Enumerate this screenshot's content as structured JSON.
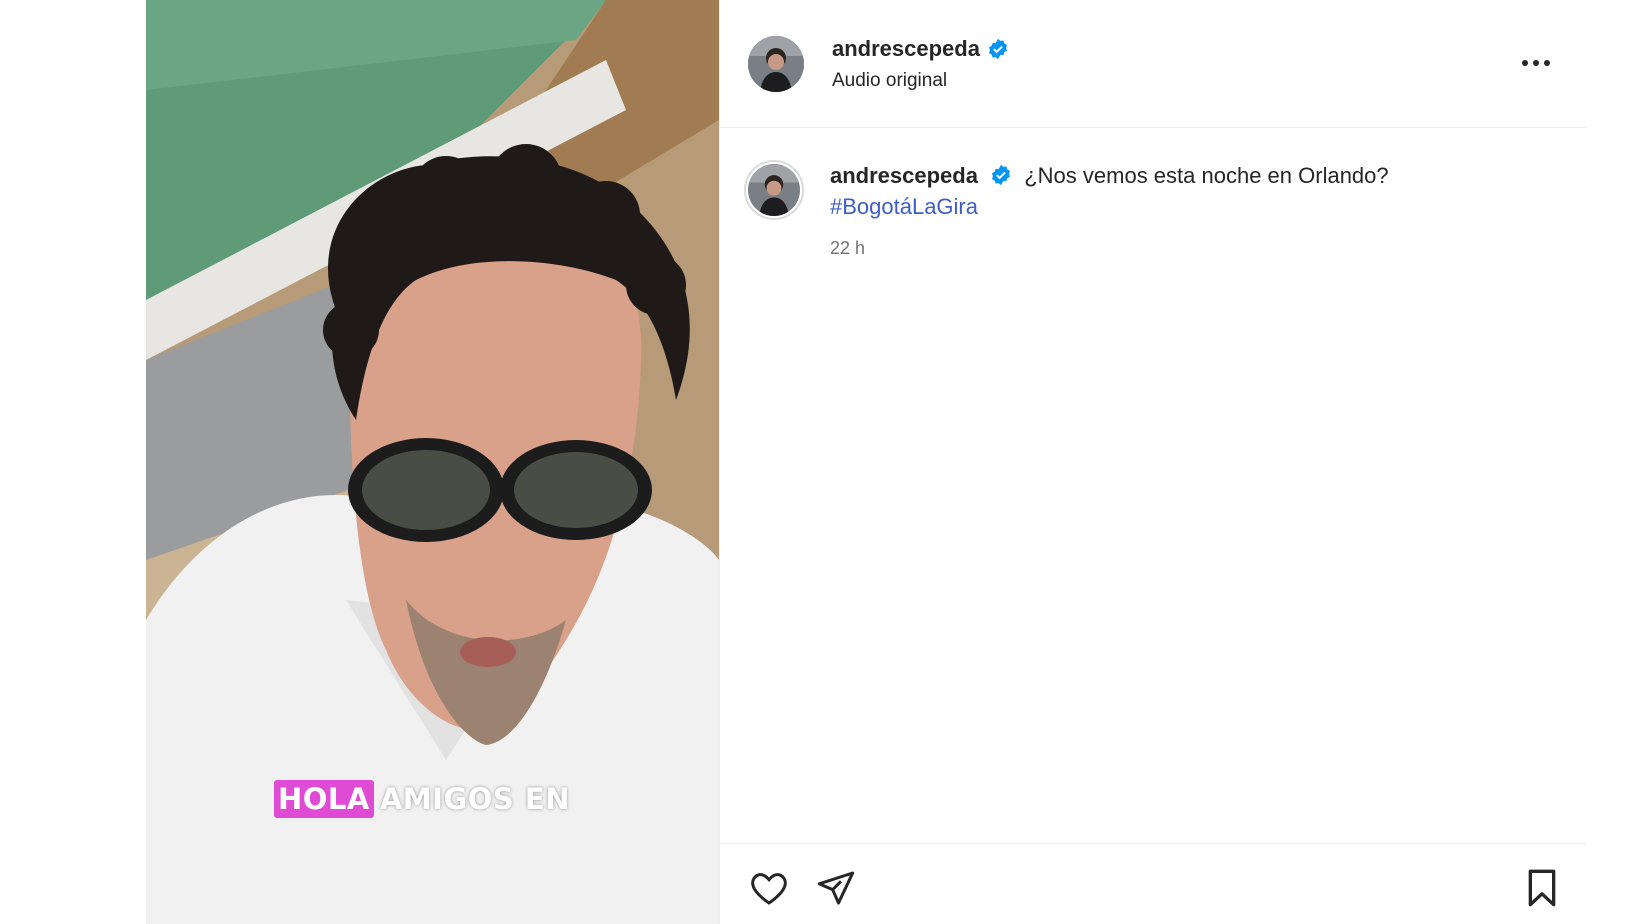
{
  "post": {
    "media": {
      "overlay_highlight": "HOLA",
      "overlay_text": "AMIGOS EN"
    },
    "header": {
      "username": "andrescepeda",
      "verified": true,
      "audio": "Audio original",
      "more_icon": "more-horizontal-icon"
    },
    "caption": {
      "username": "andrescepeda",
      "text": "¿Nos vemos esta noche en Orlando?",
      "hashtag": "#BogotáLaGira",
      "time": "22 h"
    },
    "actions": {
      "icons": [
        "heart-icon",
        "share-icon",
        "bookmark-icon"
      ]
    },
    "colors": {
      "verified": "#0095f6",
      "hashtag": "#3d5ec5",
      "caption_highlight": "#e04bd6"
    }
  }
}
